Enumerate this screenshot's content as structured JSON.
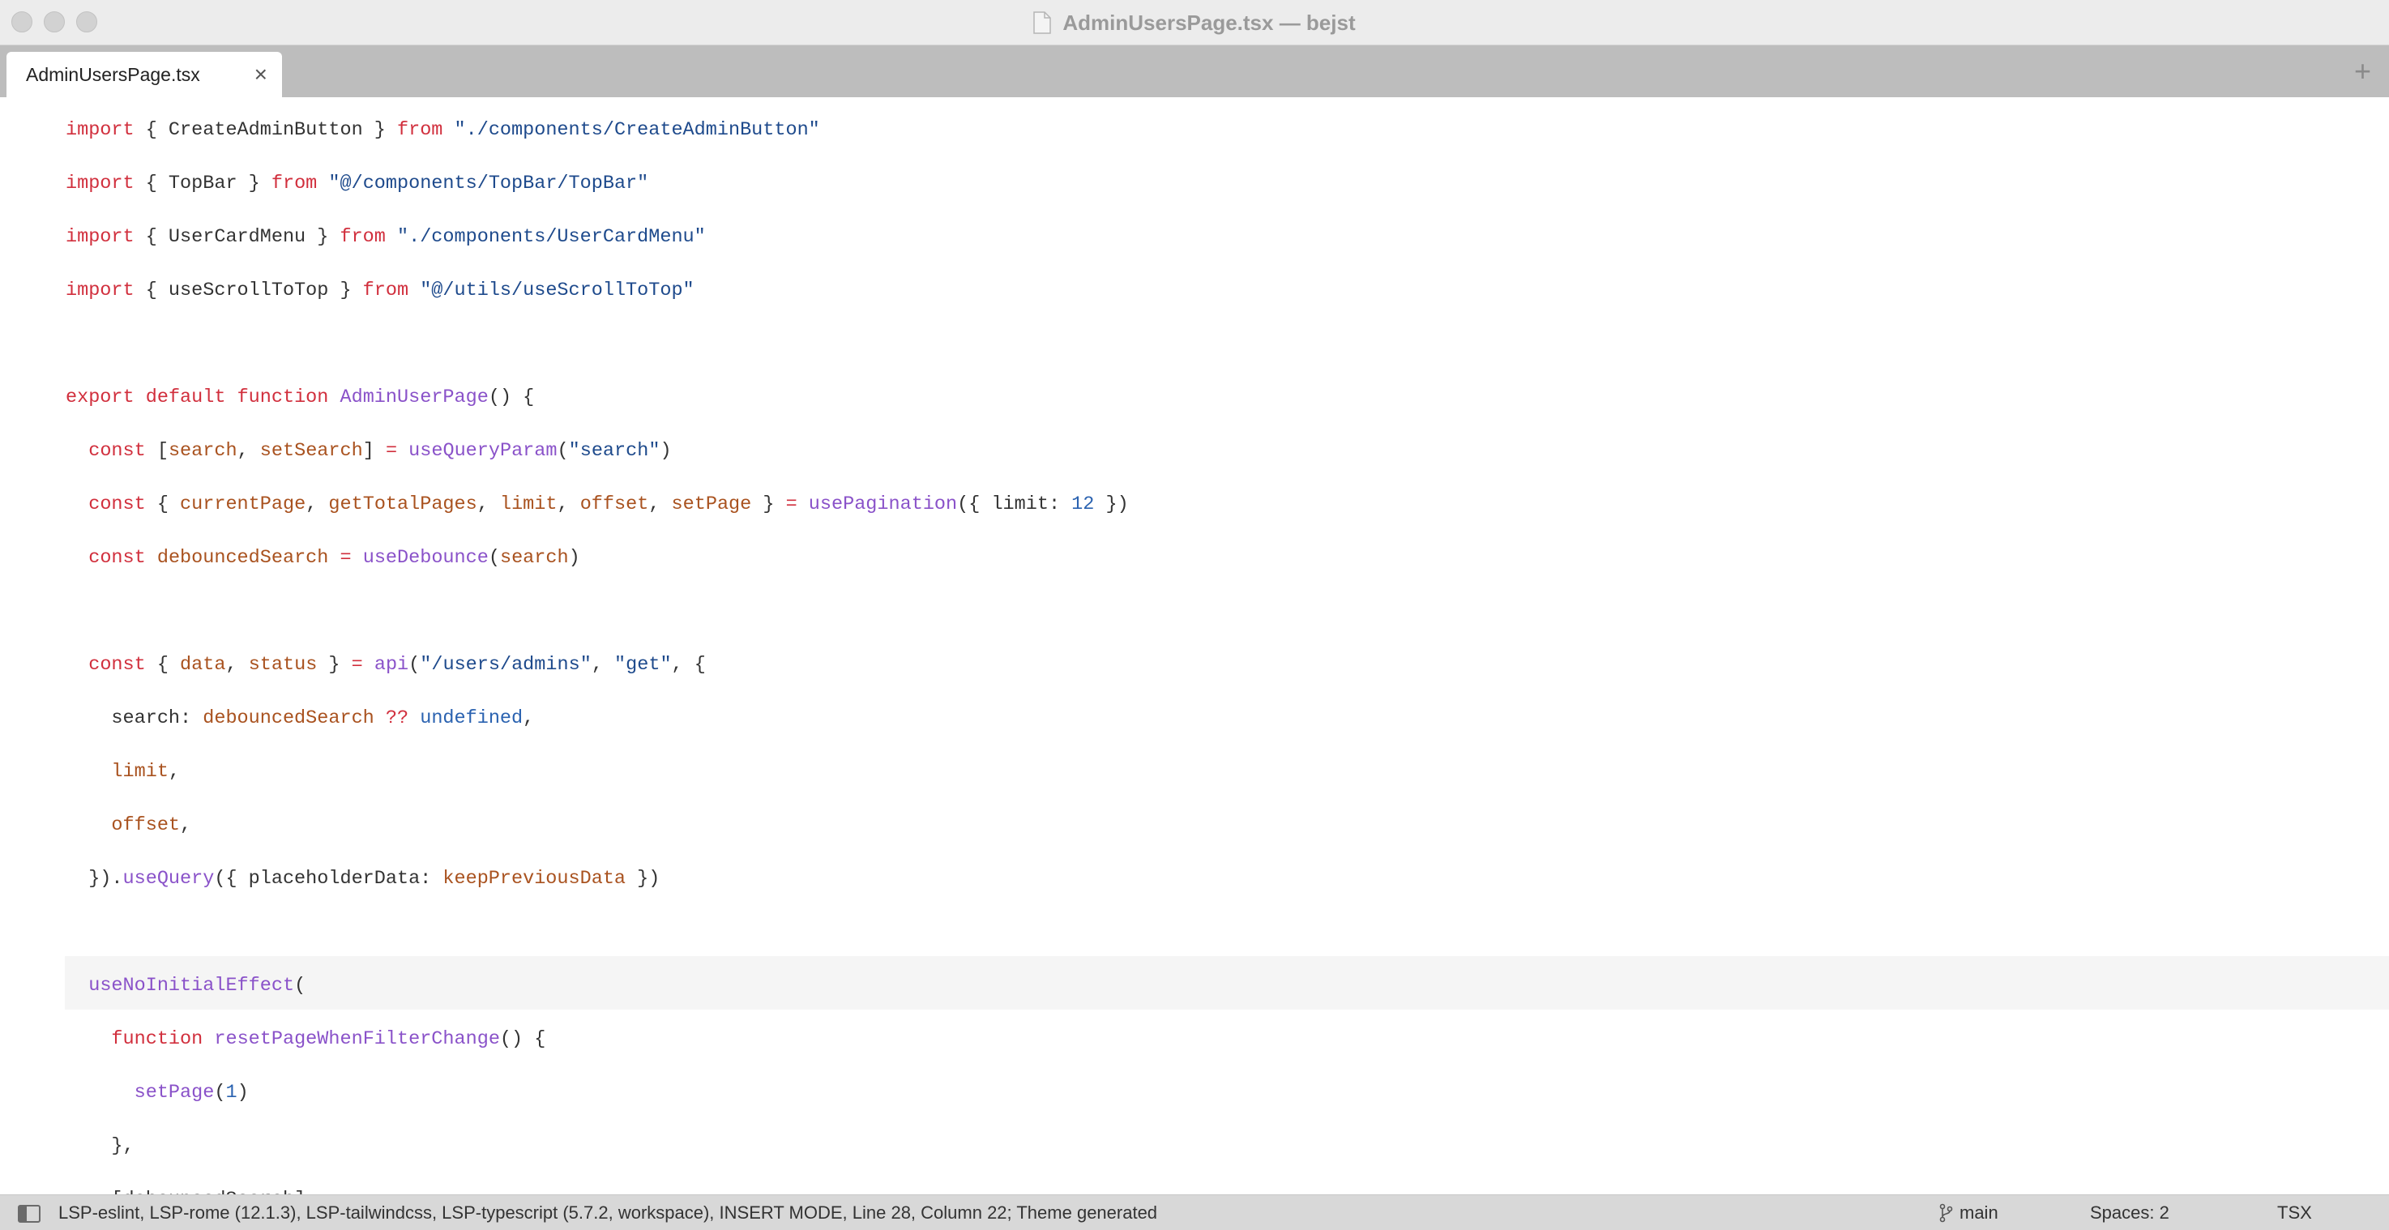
{
  "window": {
    "title": "AdminUsersPage.tsx — bejst"
  },
  "tabs": [
    {
      "label": "AdminUsersPage.tsx",
      "close": "×"
    }
  ],
  "tabbar": {
    "add": "+"
  },
  "editor": {
    "lines": [
      [
        [
          "k",
          "import"
        ],
        [
          "t",
          " { CreateAdminButton } "
        ],
        [
          "k",
          "from"
        ],
        [
          "t",
          " "
        ],
        [
          "s",
          "\"./components/CreateAdminButton\""
        ]
      ],
      [
        [
          "k",
          "import"
        ],
        [
          "t",
          " { TopBar } "
        ],
        [
          "k",
          "from"
        ],
        [
          "t",
          " "
        ],
        [
          "s",
          "\"@/components/TopBar/TopBar\""
        ]
      ],
      [
        [
          "k",
          "import"
        ],
        [
          "t",
          " { UserCardMenu } "
        ],
        [
          "k",
          "from"
        ],
        [
          "t",
          " "
        ],
        [
          "s",
          "\"./components/UserCardMenu\""
        ]
      ],
      [
        [
          "k",
          "import"
        ],
        [
          "t",
          " { useScrollToTop } "
        ],
        [
          "k",
          "from"
        ],
        [
          "t",
          " "
        ],
        [
          "s",
          "\"@/utils/useScrollToTop\""
        ]
      ],
      [],
      [
        [
          "k",
          "export"
        ],
        [
          "t",
          " "
        ],
        [
          "k",
          "default"
        ],
        [
          "t",
          " "
        ],
        [
          "k",
          "function"
        ],
        [
          "t",
          " "
        ],
        [
          "f",
          "AdminUserPage"
        ],
        [
          "t",
          "() {"
        ]
      ],
      [
        [
          "t",
          "  "
        ],
        [
          "k",
          "const"
        ],
        [
          "t",
          " ["
        ],
        [
          "v",
          "search"
        ],
        [
          "t",
          ", "
        ],
        [
          "v",
          "setSearch"
        ],
        [
          "t",
          "] "
        ],
        [
          "o",
          "="
        ],
        [
          "t",
          " "
        ],
        [
          "f",
          "useQueryParam"
        ],
        [
          "t",
          "("
        ],
        [
          "s",
          "\"search\""
        ],
        [
          "t",
          ")"
        ]
      ],
      [
        [
          "t",
          "  "
        ],
        [
          "k",
          "const"
        ],
        [
          "t",
          " { "
        ],
        [
          "v",
          "currentPage"
        ],
        [
          "t",
          ", "
        ],
        [
          "v",
          "getTotalPages"
        ],
        [
          "t",
          ", "
        ],
        [
          "v",
          "limit"
        ],
        [
          "t",
          ", "
        ],
        [
          "v",
          "offset"
        ],
        [
          "t",
          ", "
        ],
        [
          "v",
          "setPage"
        ],
        [
          "t",
          " } "
        ],
        [
          "o",
          "="
        ],
        [
          "t",
          " "
        ],
        [
          "f",
          "usePagination"
        ],
        [
          "t",
          "({ limit: "
        ],
        [
          "n",
          "12"
        ],
        [
          "t",
          " })"
        ]
      ],
      [
        [
          "t",
          "  "
        ],
        [
          "k",
          "const"
        ],
        [
          "t",
          " "
        ],
        [
          "v",
          "debouncedSearch"
        ],
        [
          "t",
          " "
        ],
        [
          "o",
          "="
        ],
        [
          "t",
          " "
        ],
        [
          "f",
          "useDebounce"
        ],
        [
          "t",
          "("
        ],
        [
          "v",
          "search"
        ],
        [
          "t",
          ")"
        ]
      ],
      [],
      [
        [
          "t",
          "  "
        ],
        [
          "k",
          "const"
        ],
        [
          "t",
          " { "
        ],
        [
          "v",
          "data"
        ],
        [
          "t",
          ", "
        ],
        [
          "v",
          "status"
        ],
        [
          "t",
          " } "
        ],
        [
          "o",
          "="
        ],
        [
          "t",
          " "
        ],
        [
          "f",
          "api"
        ],
        [
          "t",
          "("
        ],
        [
          "s",
          "\"/users/admins\""
        ],
        [
          "t",
          ", "
        ],
        [
          "s",
          "\"get\""
        ],
        [
          "t",
          ", {"
        ]
      ],
      [
        [
          "t",
          "    search: "
        ],
        [
          "v",
          "debouncedSearch"
        ],
        [
          "t",
          " "
        ],
        [
          "o",
          "??"
        ],
        [
          "t",
          " "
        ],
        [
          "n",
          "undefined"
        ],
        [
          "t",
          ","
        ]
      ],
      [
        [
          "t",
          "    "
        ],
        [
          "v",
          "limit"
        ],
        [
          "t",
          ","
        ]
      ],
      [
        [
          "t",
          "    "
        ],
        [
          "v",
          "offset"
        ],
        [
          "t",
          ","
        ]
      ],
      [
        [
          "t",
          "  })."
        ],
        [
          "f",
          "useQuery"
        ],
        [
          "t",
          "({ placeholderData: "
        ],
        [
          "v",
          "keepPreviousData"
        ],
        [
          "t",
          " })"
        ]
      ],
      [],
      [
        [
          "t",
          "  "
        ],
        [
          "f",
          "useNoInitialEffect"
        ],
        [
          "t",
          "("
        ]
      ],
      [
        [
          "t",
          "    "
        ],
        [
          "k",
          "function"
        ],
        [
          "t",
          " "
        ],
        [
          "f",
          "resetPageWhenFilterChange"
        ],
        [
          "t",
          "() {"
        ]
      ],
      [
        [
          "t",
          "      "
        ],
        [
          "f",
          "setPage"
        ],
        [
          "t",
          "("
        ],
        [
          "n",
          "1"
        ],
        [
          "t",
          ")"
        ]
      ],
      [
        [
          "t",
          "    },"
        ]
      ],
      [
        [
          "t",
          "    [debouncedSearch],"
        ]
      ]
    ]
  },
  "statusbar": {
    "info": "LSP-eslint, LSP-rome (12.1.3), LSP-tailwindcss, LSP-typescript (5.7.2, workspace), INSERT MODE, Line 28, Column 22; Theme generated",
    "branch": "main",
    "spaces": "Spaces: 2",
    "syntax": "TSX"
  },
  "icons": {
    "traffic_lights": [
      "close-icon",
      "minimize-icon",
      "zoom-icon"
    ],
    "document": "document-icon",
    "sidebar": "sidebar-toggle-icon",
    "branch": "git-branch-icon"
  },
  "colors": {
    "keyword": "#d12f3d",
    "string": "#1e4a8c",
    "function": "#8a52c9",
    "variable": "#a9521f",
    "number": "#2a62b0"
  }
}
